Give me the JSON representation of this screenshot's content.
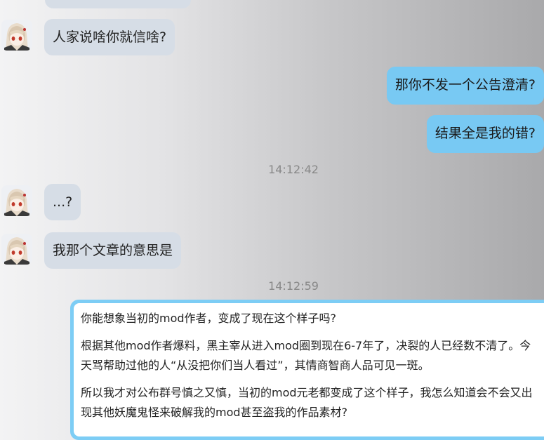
{
  "colors": {
    "incoming_bubble": "#d6dde6",
    "outgoing_bubble": "#78c9f3",
    "card_border": "#7dcdf5"
  },
  "messages": [
    {
      "side": "in",
      "text": ""
    },
    {
      "side": "in",
      "text": "人家说啥你就信啥?"
    },
    {
      "side": "out",
      "text": "那你不发一个公告澄清?"
    },
    {
      "side": "out",
      "text": "结果全是我的错?"
    },
    {
      "side": "in",
      "text": "...?"
    },
    {
      "side": "in",
      "text": "我那个文章的意思是"
    }
  ],
  "timestamps": [
    "14:12:42",
    "14:12:59"
  ],
  "card": {
    "paragraphs": [
      "你能想象当初的mod作者，变成了现在这个样子吗?",
      "根据其他mod作者爆料，黑主宰从进入mod圈到现在6-7年了，决裂的人已经数不清了。今天骂帮助过他的人“从没把你们当人看过”，其情商智商人品可见一斑。",
      "所以我才对公布群号慎之又慎，当初的mod元老都变成了这个样子，我怎么知道会不会又出现其他妖魔鬼怪来破解我的mod甚至盗我的作品素材?"
    ]
  }
}
